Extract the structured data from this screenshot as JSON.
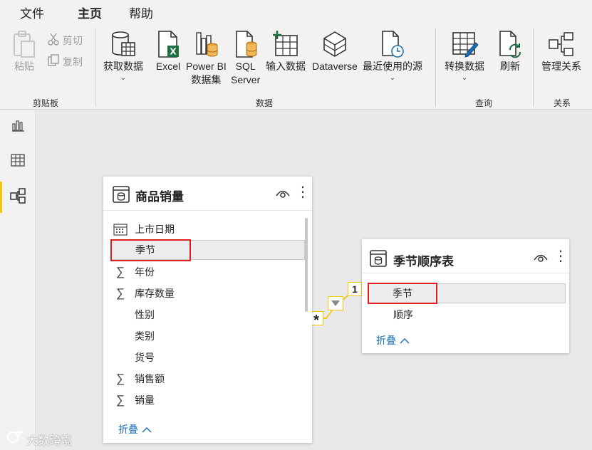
{
  "menu": {
    "tabs": [
      {
        "label": "文件"
      },
      {
        "label": "主页"
      },
      {
        "label": "帮助"
      }
    ]
  },
  "ribbon": {
    "clipboard": {
      "paste_label": "粘贴",
      "cut_label": "剪切",
      "copy_label": "复制",
      "group_label": "剪贴板"
    },
    "data": {
      "get_data_label": "获取数据",
      "excel_label": "Excel",
      "powerbi_line1": "Power BI",
      "powerbi_line2": "数据集",
      "sql_line1": "SQL",
      "sql_line2": "Server",
      "enter_data_label": "输入数据",
      "dataverse_label": "Dataverse",
      "recent_sources_label": "最近使用的源",
      "group_label": "数据"
    },
    "query": {
      "transform_label": "转换数据",
      "refresh_label": "刷新",
      "group_label": "查询"
    },
    "relations": {
      "manage_label": "管理关系",
      "group_label": "关系"
    }
  },
  "left_table": {
    "title": "商品销量",
    "fields": [
      {
        "name": "上市日期",
        "icon": "calendar-icon"
      },
      {
        "name": "季节",
        "icon": "none"
      },
      {
        "name": "年份",
        "icon": "sigma-icon"
      },
      {
        "name": "库存数量",
        "icon": "sigma-icon"
      },
      {
        "name": "性别",
        "icon": "none"
      },
      {
        "name": "类别",
        "icon": "none"
      },
      {
        "name": "货号",
        "icon": "none"
      },
      {
        "name": "销售额",
        "icon": "sigma-icon"
      },
      {
        "name": "销量",
        "icon": "sigma-icon"
      }
    ],
    "collapse_label": "折叠"
  },
  "right_table": {
    "title": "季节顺序表",
    "fields": [
      {
        "name": "季节",
        "icon": "none"
      },
      {
        "name": "顺序",
        "icon": "none"
      }
    ],
    "collapse_label": "折叠"
  },
  "relationship": {
    "many_label": "*",
    "one_label": "1"
  },
  "watermark": "大数跨境",
  "colors": {
    "accent_yellow": "#f2c811",
    "highlight_red": "#e02020",
    "link_blue": "#1c6fb5",
    "excel_green": "#1d7044",
    "db_orange": "#e8a23c"
  }
}
